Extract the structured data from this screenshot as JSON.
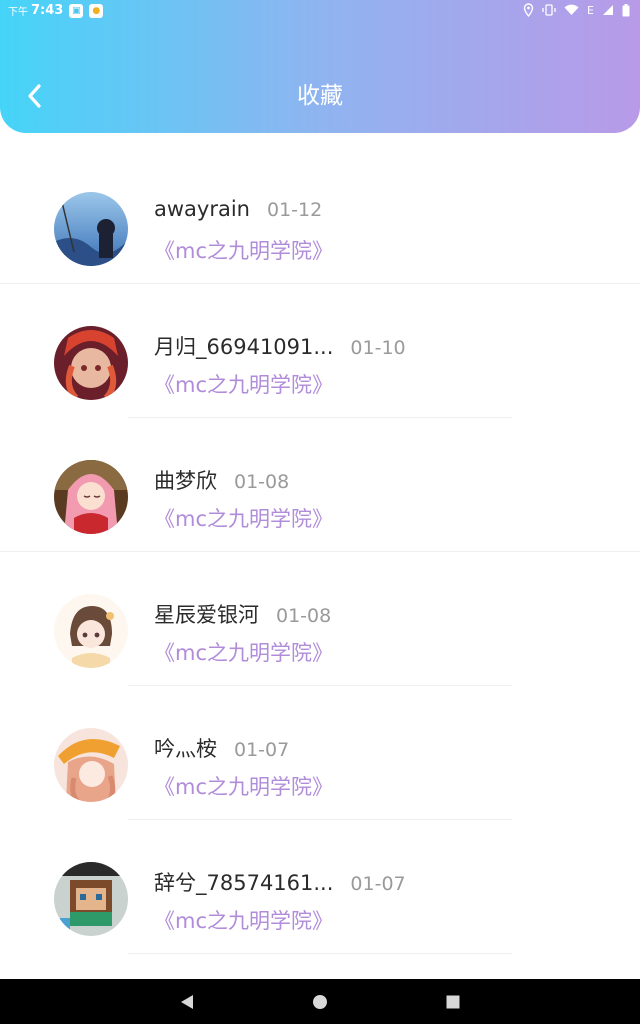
{
  "status_bar": {
    "ampm": "下午",
    "time": "7:43",
    "network": "E"
  },
  "header": {
    "title": "收藏"
  },
  "favorites": [
    {
      "name": "awayrain",
      "date": "01-12",
      "book": "《mc之九明学院》"
    },
    {
      "name": "月归_66941091...",
      "date": "01-10",
      "book": "《mc之九明学院》"
    },
    {
      "name": "曲梦欣",
      "date": "01-08",
      "book": "《mc之九明学院》"
    },
    {
      "name": "星辰爱银河",
      "date": "01-08",
      "book": "《mc之九明学院》"
    },
    {
      "name": "吟灬桉",
      "date": "01-07",
      "book": "《mc之九明学院》"
    },
    {
      "name": "辞兮_78574161...",
      "date": "01-07",
      "book": "《mc之九明学院》"
    }
  ],
  "colors": {
    "header_gradient_start": "#45d4f8",
    "header_gradient_end": "#b89ae8",
    "book_title": "#b08cd9",
    "date": "#9a9a9a"
  },
  "icons": {
    "back": "chevron-left-icon",
    "nav_back": "triangle-back-icon",
    "nav_home": "circle-home-icon",
    "nav_recents": "square-recents-icon"
  }
}
